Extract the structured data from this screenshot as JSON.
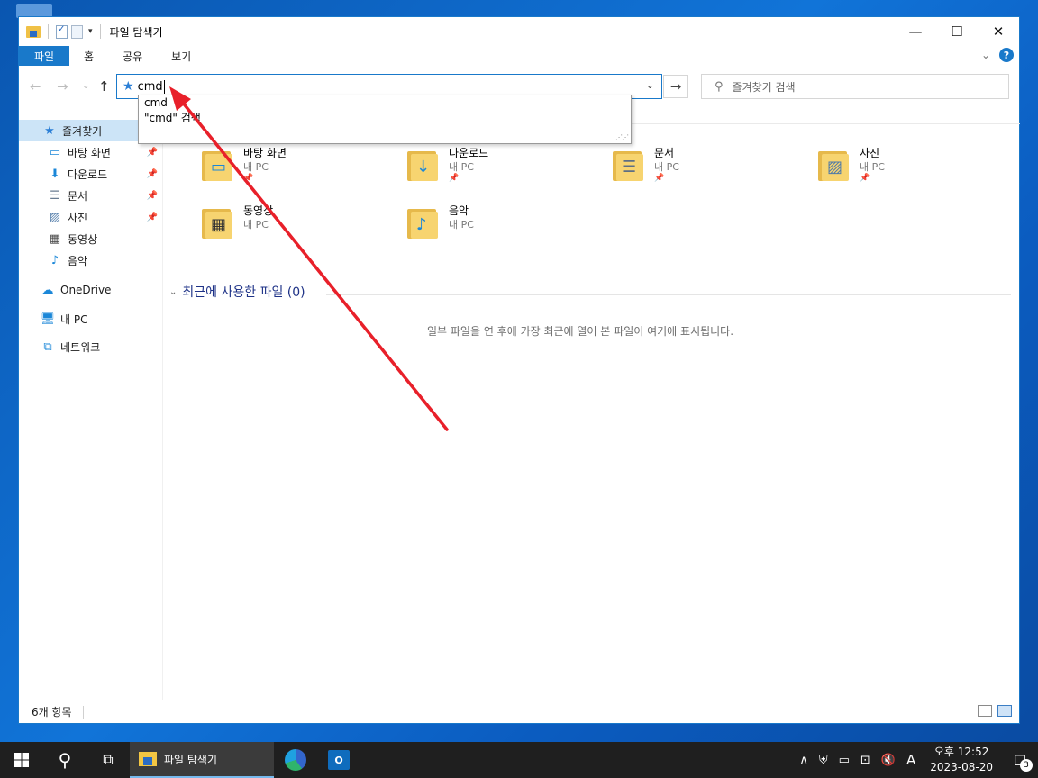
{
  "window": {
    "title": "파일 탐색기",
    "controls": {
      "minimize": "—",
      "maximize": "☐",
      "close": "✕"
    }
  },
  "ribbon": {
    "tabs": [
      "파일",
      "홈",
      "공유",
      "보기"
    ],
    "help": "?"
  },
  "address": {
    "value": "cmd",
    "back": "←",
    "forward": "→",
    "recent": "⌄",
    "up": "↑",
    "go": "→"
  },
  "search": {
    "placeholder": "즐겨찾기 검색"
  },
  "autocomplete": {
    "options": [
      "cmd",
      "\"cmd\" 검색"
    ]
  },
  "sidebar": {
    "quick_access": "즐겨찾기",
    "items": [
      {
        "label": "바탕 화면",
        "icon": "desktop-icon",
        "pinned": true
      },
      {
        "label": "다운로드",
        "icon": "download-icon",
        "pinned": true
      },
      {
        "label": "문서",
        "icon": "document-icon",
        "pinned": true
      },
      {
        "label": "사진",
        "icon": "picture-icon",
        "pinned": true
      },
      {
        "label": "동영상",
        "icon": "video-icon",
        "pinned": false
      },
      {
        "label": "음악",
        "icon": "music-icon",
        "pinned": false
      }
    ],
    "onedrive": "OneDrive",
    "this_pc": "내 PC",
    "network": "네트워크"
  },
  "folders": [
    {
      "name": "바탕 화면",
      "location": "내 PC",
      "pinned": true,
      "glyph": "▭"
    },
    {
      "name": "다운로드",
      "location": "내 PC",
      "pinned": true,
      "glyph": "↓"
    },
    {
      "name": "문서",
      "location": "내 PC",
      "pinned": true,
      "glyph": "☰"
    },
    {
      "name": "사진",
      "location": "내 PC",
      "pinned": true,
      "glyph": "▨"
    },
    {
      "name": "동영상",
      "location": "내 PC",
      "pinned": false,
      "glyph": "▦"
    },
    {
      "name": "음악",
      "location": "내 PC",
      "pinned": false,
      "glyph": "♪"
    }
  ],
  "recent": {
    "header": "최근에 사용한 파일 (0)",
    "empty_message": "일부 파일을 연 후에 가장 최근에 열어 본 파일이 여기에 표시됩니다."
  },
  "status": {
    "item_count": "6개 항목"
  },
  "taskbar": {
    "active_app": "파일 탐색기",
    "time": "오후 12:52",
    "date": "2023-08-20",
    "ime": "A",
    "notification_count": "3"
  },
  "colors": {
    "accent": "#1979CA",
    "arrow": "#E8202A",
    "taskbar": "#1F1F1F"
  }
}
